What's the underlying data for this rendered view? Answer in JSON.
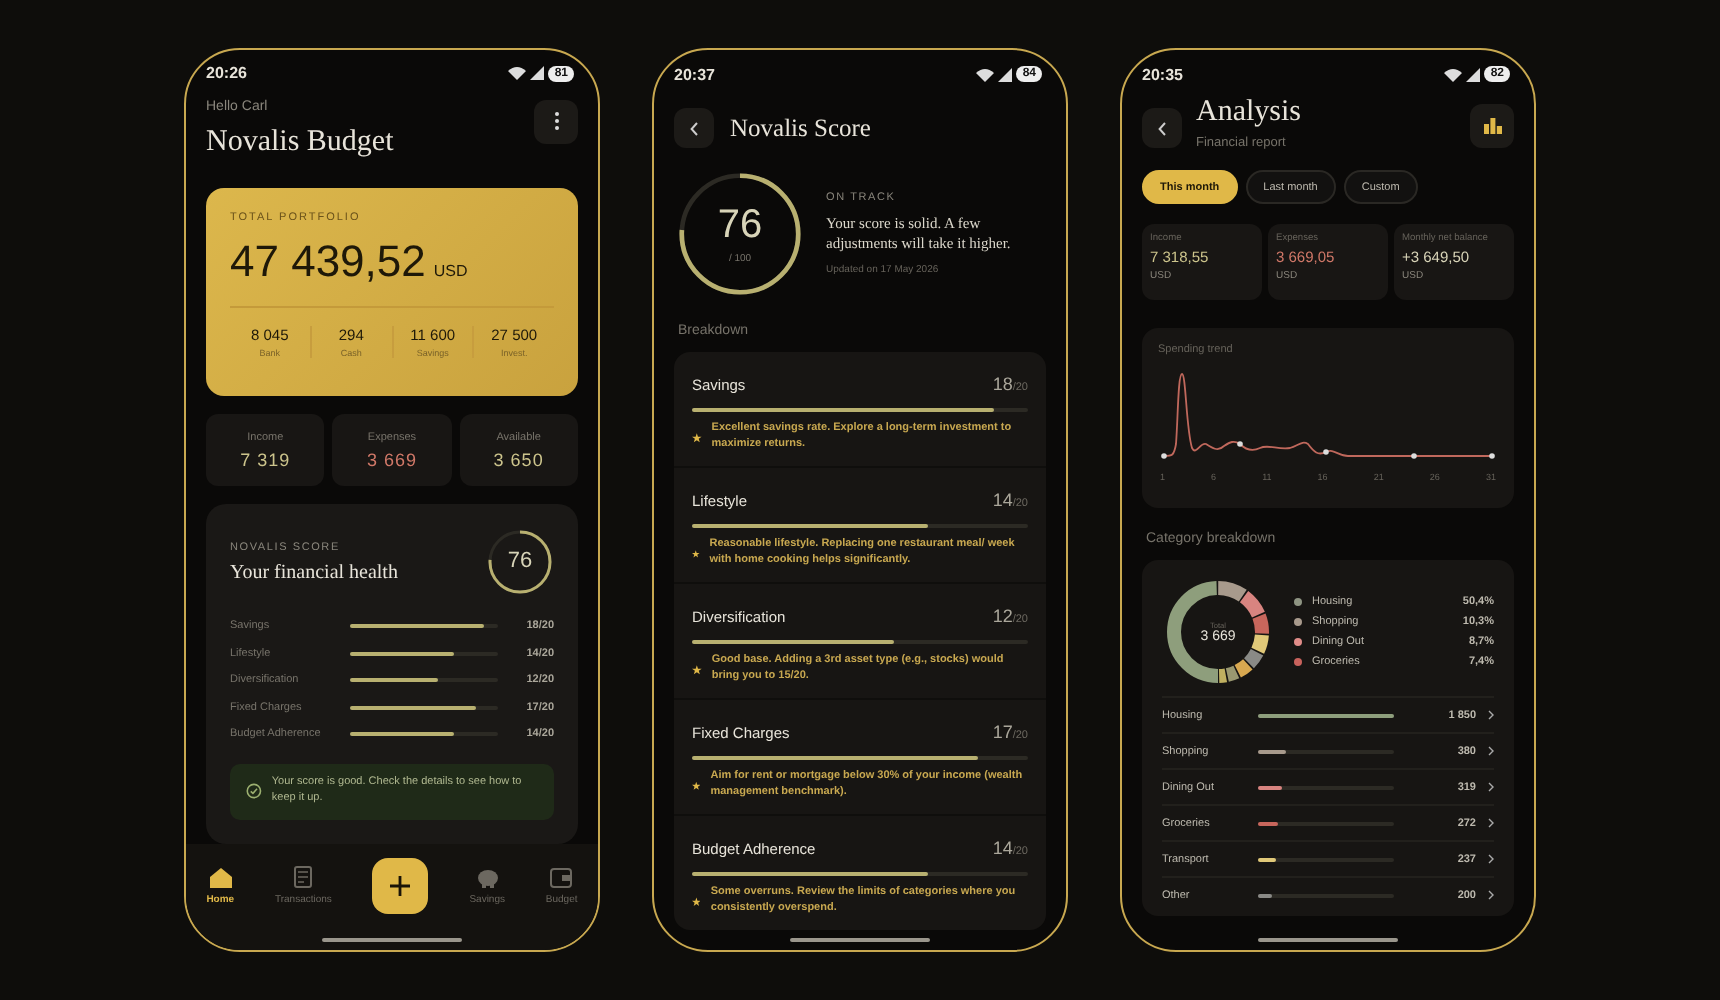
{
  "home": {
    "status": {
      "time": "20:26",
      "battery": "81"
    },
    "greeting": "Hello Carl",
    "title": "Novalis Budget",
    "portfolio": {
      "label": "TOTAL PORTFOLIO",
      "amount": "47 439,52",
      "currency": "USD",
      "accounts": [
        {
          "value": "8 045",
          "label": "Bank"
        },
        {
          "value": "294",
          "label": "Cash"
        },
        {
          "value": "11 600",
          "label": "Savings"
        },
        {
          "value": "27 500",
          "label": "Invest."
        }
      ]
    },
    "summary": [
      {
        "label": "Income",
        "value": "7 319",
        "kind": "plain"
      },
      {
        "label": "Expenses",
        "value": "3 669",
        "kind": "negative"
      },
      {
        "label": "Available",
        "value": "3 650",
        "kind": "plain"
      }
    ],
    "score": {
      "eyebrow": "NOVALIS SCORE",
      "title": "Your financial health",
      "value": "76",
      "items": [
        {
          "label": "Savings",
          "level": 0.9,
          "value": "18/20"
        },
        {
          "label": "Lifestyle",
          "level": 0.7,
          "value": "14/20"
        },
        {
          "label": "Diversification",
          "level": 0.6,
          "value": "12/20"
        },
        {
          "label": "Fixed Charges",
          "level": 0.85,
          "value": "17/20"
        },
        {
          "label": "Budget Adherence",
          "level": 0.7,
          "value": "14/20"
        }
      ],
      "message": "Your score is good. Check the details to see how to keep it up."
    },
    "nav": [
      {
        "kind": "home",
        "label": "Home",
        "selected": true
      },
      {
        "kind": "receipt",
        "label": "Transactions",
        "selected": false
      },
      {
        "kind": "add"
      },
      {
        "kind": "piggy",
        "label": "Savings",
        "selected": false
      },
      {
        "kind": "wallet",
        "label": "Budget",
        "selected": false
      }
    ]
  },
  "score": {
    "status": {
      "time": "20:37",
      "battery": "84"
    },
    "title": "Novalis Score",
    "value": "76",
    "out_of": "/ 100",
    "level": 0.76,
    "state": "ON TRACK",
    "summary": "Your score is solid. A few adjustments will take it higher.",
    "updated": "Updated on 17 May 2026",
    "section": "Breakdown",
    "items": [
      {
        "name": "Savings",
        "score": "18",
        "max": "/20",
        "level": 0.9,
        "tip": "Excellent savings rate. Explore a long-term investment to maximize returns."
      },
      {
        "name": "Lifestyle",
        "score": "14",
        "max": "/20",
        "level": 0.7,
        "tip": "Reasonable lifestyle. Replacing one restaurant meal/ week with home cooking helps significantly."
      },
      {
        "name": "Diversification",
        "score": "12",
        "max": "/20",
        "level": 0.6,
        "tip": "Good base. Adding a 3rd asset type (e.g., stocks) would bring you to 15/20."
      },
      {
        "name": "Fixed Charges",
        "score": "17",
        "max": "/20",
        "level": 0.85,
        "tip": "Aim for rent or mortgage below 30% of your income (wealth management benchmark)."
      },
      {
        "name": "Budget Adherence",
        "score": "14",
        "max": "/20",
        "level": 0.7,
        "tip": "Some overruns. Review the limits of categories where you consistently overspend."
      }
    ]
  },
  "analysis": {
    "status": {
      "time": "20:35",
      "battery": "82"
    },
    "title": "Analysis",
    "subtitle": "Financial report",
    "periods": [
      {
        "label": "This month",
        "selected": true
      },
      {
        "label": "Last month",
        "selected": false
      },
      {
        "label": "Custom",
        "selected": false
      }
    ],
    "stats": [
      {
        "label": "Income",
        "value": "7 318,55",
        "currency": "USD",
        "kind": "plain"
      },
      {
        "label": "Expenses",
        "value": "3 669,05",
        "currency": "USD",
        "kind": "negative"
      },
      {
        "label": "Monthly net balance",
        "value": "+3 649,50",
        "currency": "USD",
        "kind": "positive"
      }
    ],
    "trend": {
      "title": "Spending trend",
      "x_labels": [
        "1",
        "6",
        "11",
        "16",
        "21",
        "26",
        "31"
      ]
    },
    "breakdown_title": "Category breakdown",
    "donut": {
      "label": "Total",
      "value": "3 669"
    },
    "legend": [
      {
        "name": "Housing",
        "share": "50,4%",
        "color": "#8e9482"
      },
      {
        "name": "Shopping",
        "share": "10,3%",
        "color": "#a89a8c"
      },
      {
        "name": "Dining Out",
        "share": "8,7%",
        "color": "#e08c88"
      },
      {
        "name": "Groceries",
        "share": "7,4%",
        "color": "#c8625c"
      }
    ],
    "categories": [
      {
        "name": "Housing",
        "amount": "1 850",
        "level": 1,
        "color": "#8e9e7c"
      },
      {
        "name": "Shopping",
        "amount": "380",
        "level": 0.2,
        "color": "#a89a8c"
      },
      {
        "name": "Dining Out",
        "amount": "319",
        "level": 0.17,
        "color": "#d88480"
      },
      {
        "name": "Groceries",
        "amount": "272",
        "level": 0.15,
        "color": "#c8665c"
      },
      {
        "name": "Transport",
        "amount": "237",
        "level": 0.13,
        "color": "#e0c878"
      },
      {
        "name": "Other",
        "amount": "200",
        "level": 0.1,
        "color": "#8a8a86"
      }
    ]
  }
}
